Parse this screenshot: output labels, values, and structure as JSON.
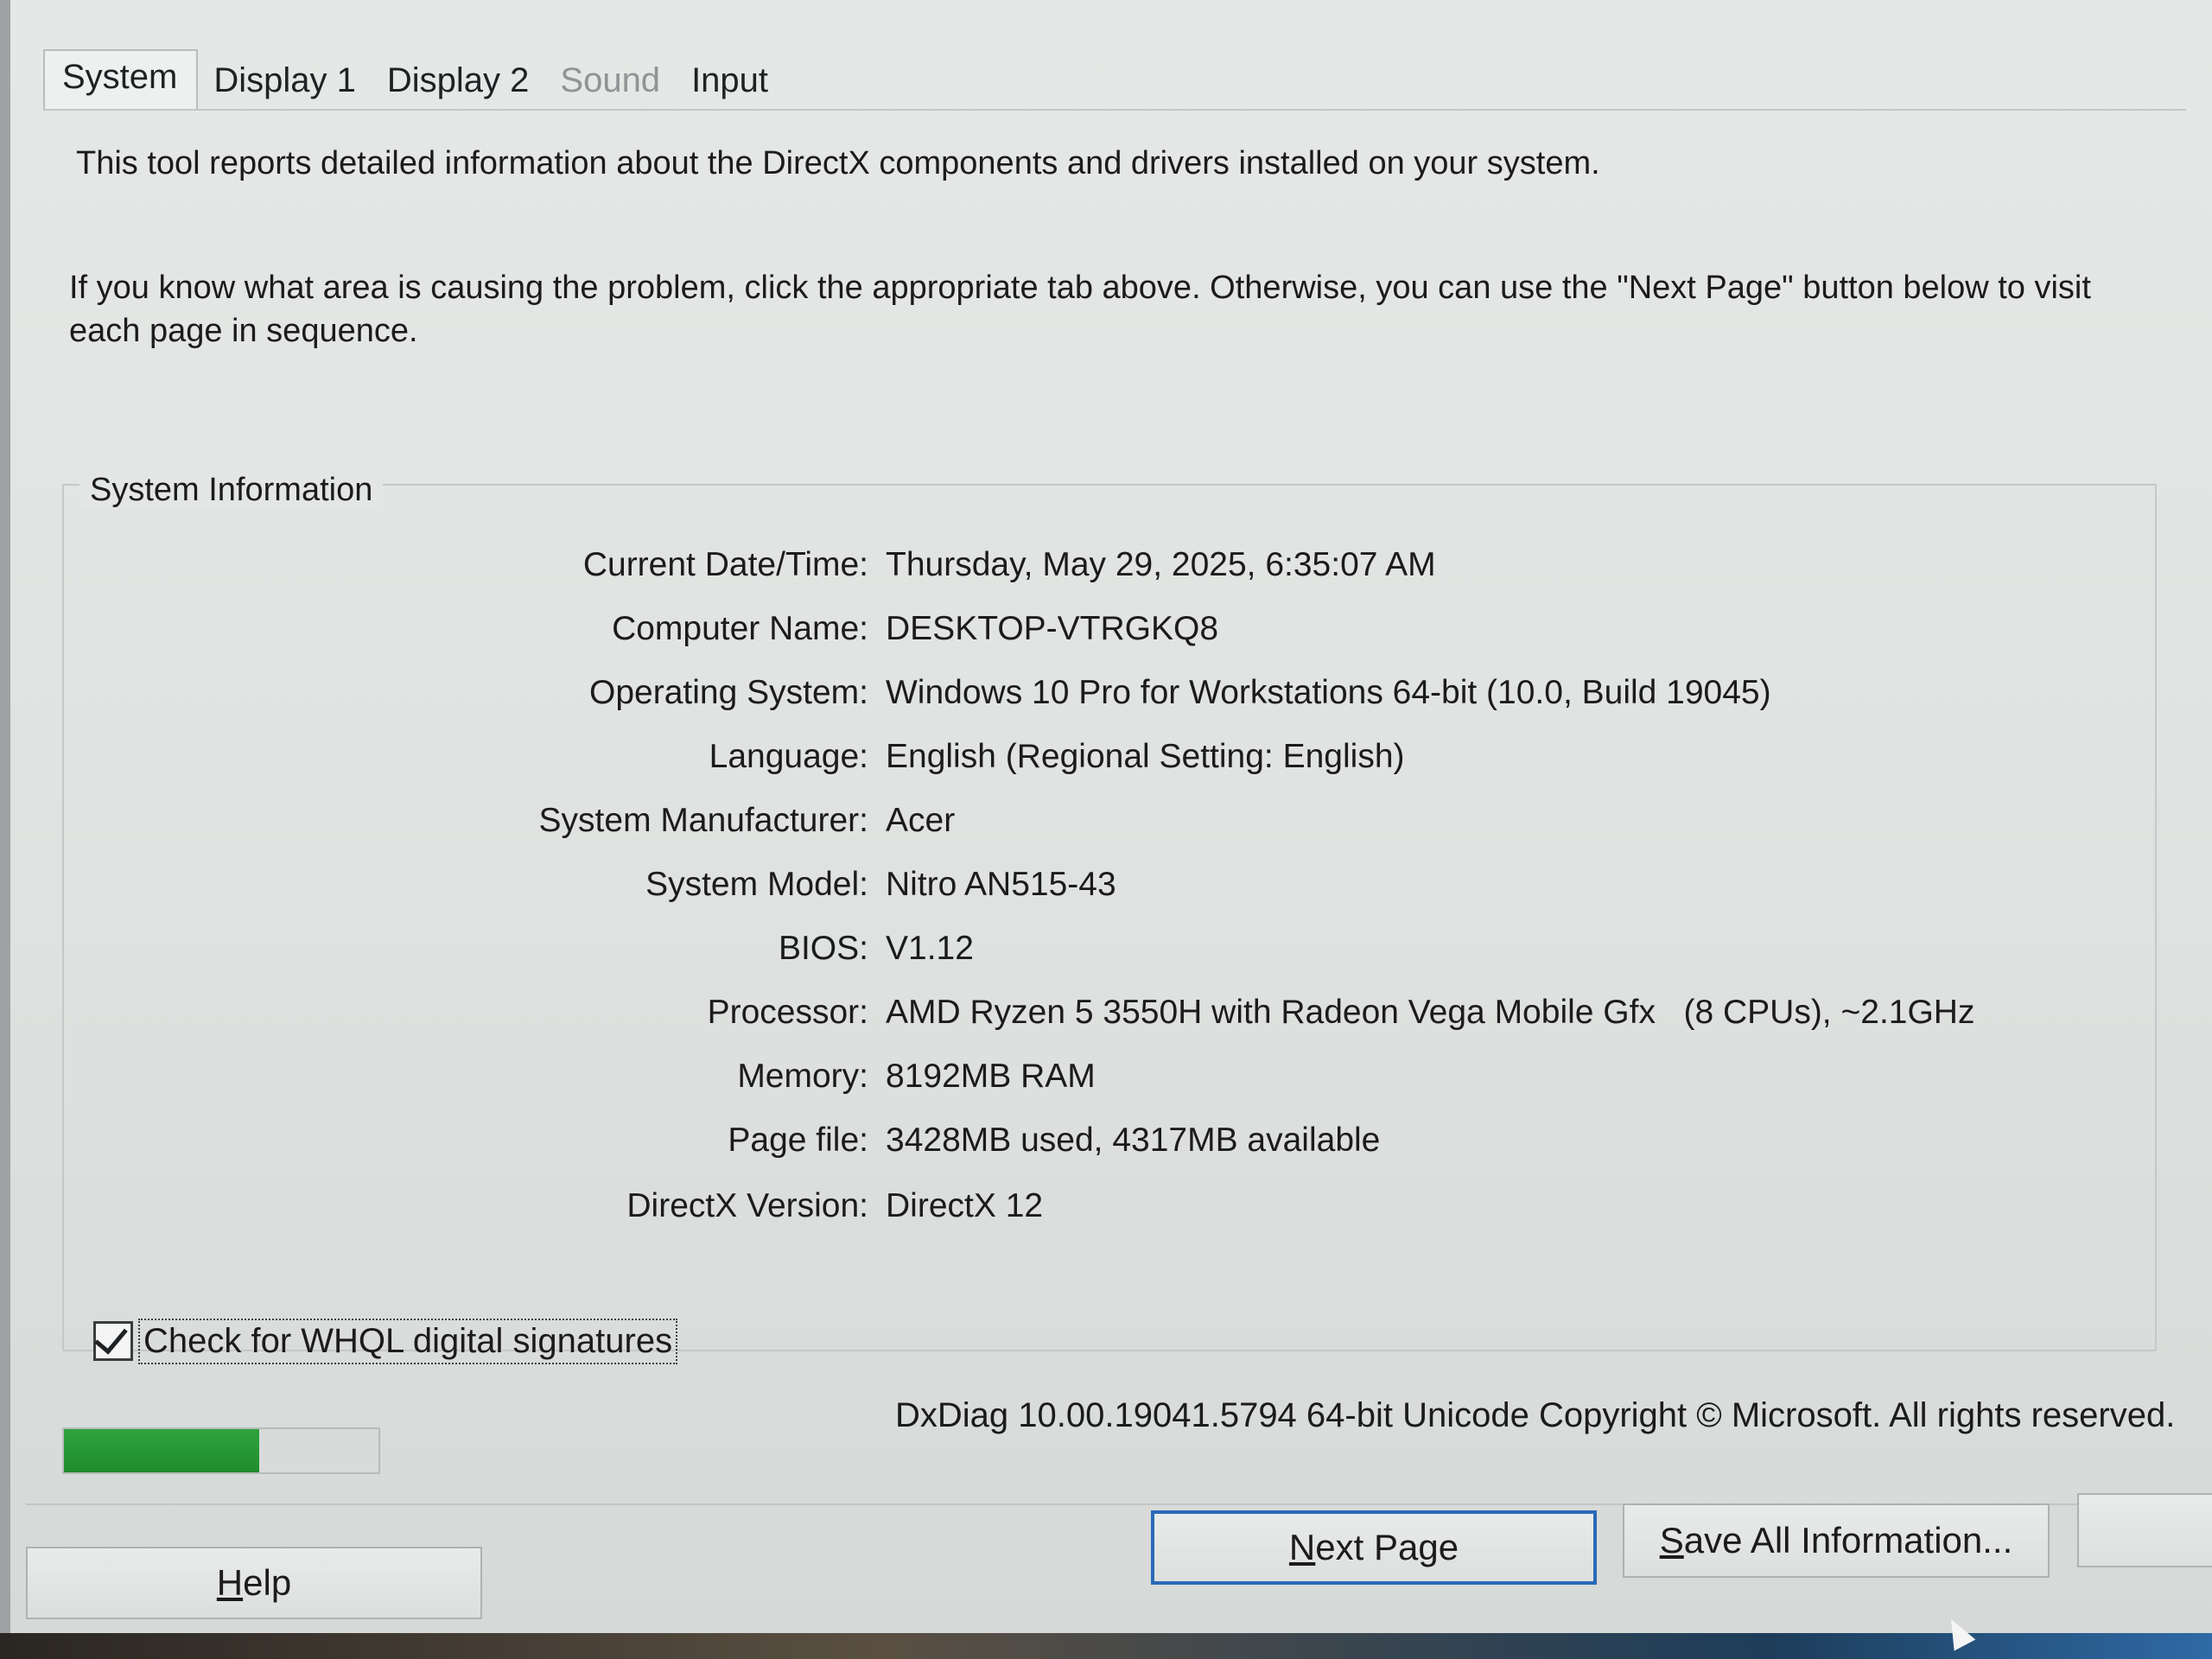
{
  "tabs": [
    {
      "label": "System",
      "active": true
    },
    {
      "label": "Display 1",
      "active": false
    },
    {
      "label": "Display 2",
      "active": false
    },
    {
      "label": "Sound",
      "active": false
    },
    {
      "label": "Input",
      "active": false
    }
  ],
  "intro": {
    "line1": "This tool reports detailed information about the DirectX components and drivers installed on your system.",
    "line2": "If you know what area is causing the problem, click the appropriate tab above.  Otherwise, you can use the \"Next Page\" button below to visit each page in sequence."
  },
  "system_info": {
    "title": "System Information",
    "rows": [
      {
        "label": "Current Date/Time:",
        "value": "Thursday, May 29, 2025, 6:35:07 AM"
      },
      {
        "label": "Computer Name:",
        "value": "DESKTOP-VTRGKQ8"
      },
      {
        "label": "Operating System:",
        "value": "Windows 10 Pro for Workstations 64-bit (10.0, Build 19045)"
      },
      {
        "label": "Language:",
        "value": "English (Regional Setting: English)"
      },
      {
        "label": "System Manufacturer:",
        "value": "Acer"
      },
      {
        "label": "System Model:",
        "value": "Nitro AN515-43"
      },
      {
        "label": "BIOS:",
        "value": "V1.12"
      },
      {
        "label": "Processor:",
        "value": "AMD Ryzen 5 3550H with Radeon Vega Mobile Gfx   (8 CPUs), ~2.1GHz"
      },
      {
        "label": "Memory:",
        "value": "8192MB RAM"
      },
      {
        "label": "Page file:",
        "value": "3428MB used, 4317MB available"
      },
      {
        "label": "DirectX Version:",
        "value": "DirectX 12"
      }
    ]
  },
  "whql": {
    "label": "Check for WHQL digital signatures",
    "checked": true
  },
  "progress": {
    "fraction": 0.62,
    "color": "#239a34"
  },
  "footer": {
    "text": "DxDiag 10.00.19041.5794 64-bit Unicode  Copyright © Microsoft. All rights reserved."
  },
  "buttons": {
    "help": "Help",
    "next": "Next Page",
    "save": "Save All Information...",
    "exit": ""
  },
  "colors": {
    "accent": "#2a6ab8"
  }
}
